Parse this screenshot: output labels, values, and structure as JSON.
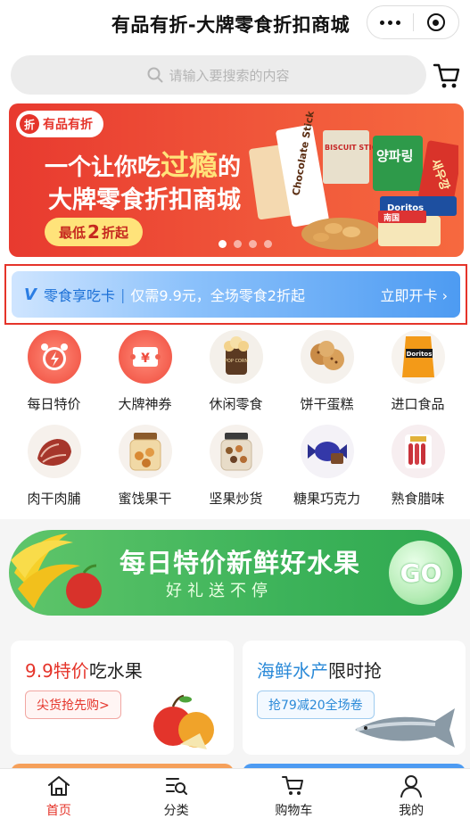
{
  "header": {
    "title": "有品有折-大牌零食折扣商城",
    "more_icon": "more-dots-icon",
    "close_icon": "target-circle-icon"
  },
  "search": {
    "placeholder": "请输入要搜索的内容",
    "icon": "search-icon",
    "cart_icon": "cart-icon"
  },
  "banner": {
    "brand": "有品有折",
    "brand_logo_text": "折",
    "line1_pre": "一个让你吃",
    "line1_highlight": "过瘾",
    "line1_post": "的",
    "line2": "大牌零食折扣商城",
    "pill_pre": "最低",
    "pill_num": "2",
    "pill_post": "折起",
    "product_texts": [
      "Chocolate Stick",
      "BISCUIT STICK",
      "양파링",
      "새우깡",
      "Doritos",
      "南国"
    ],
    "slide_count": 4,
    "active_slide": 1
  },
  "member_card": {
    "mark": "V",
    "title": "零食享吃卡",
    "separator": "|",
    "desc": "仅需9.9元，全场零食2折起",
    "action": "立即开卡",
    "action_arrow": "›",
    "highlight_color": "#e5342a"
  },
  "categories": [
    {
      "label": "每日特价",
      "icon": "alarm-clock-icon"
    },
    {
      "label": "大牌神券",
      "icon": "coupon-icon"
    },
    {
      "label": "休闲零食",
      "icon": "popcorn-icon",
      "icon_text": "POP CORN"
    },
    {
      "label": "饼干蛋糕",
      "icon": "cookies-icon"
    },
    {
      "label": "进口食品",
      "icon": "doritos-chips-icon",
      "icon_text": "Doritos"
    },
    {
      "label": "肉干肉脯",
      "icon": "jerky-icon"
    },
    {
      "label": "蜜饯果干",
      "icon": "dried-fruit-jar-icon"
    },
    {
      "label": "坚果炒货",
      "icon": "nuts-jar-icon"
    },
    {
      "label": "糖果巧克力",
      "icon": "candy-icon"
    },
    {
      "label": "熟食腊味",
      "icon": "sausage-icon"
    }
  ],
  "fruit_banner": {
    "title": "每日特价新鲜好水果",
    "subtitle": "好礼送不停",
    "go": "GO",
    "icon": "fruit-basket-icon"
  },
  "promos": [
    {
      "title_highlight": "9.9特价",
      "title_rest": "吃水果",
      "tag": "尖货抢先购>",
      "icon": "apple-icon"
    },
    {
      "title_highlight": "海鲜水产",
      "title_rest": "限时抢",
      "tag": "抢79减20全场卷",
      "icon": "fish-icon"
    }
  ],
  "tabbar": [
    {
      "label": "首页",
      "icon": "home-icon",
      "active": true
    },
    {
      "label": "分类",
      "icon": "category-search-icon",
      "active": false
    },
    {
      "label": "购物车",
      "icon": "cart-icon",
      "active": false
    },
    {
      "label": "我的",
      "icon": "user-icon",
      "active": false
    }
  ],
  "colors": {
    "brand_red": "#e5342a",
    "card_blue": "#4d9bf2",
    "fruit_green": "#3db35a",
    "promo_blue": "#2b8ad8"
  }
}
